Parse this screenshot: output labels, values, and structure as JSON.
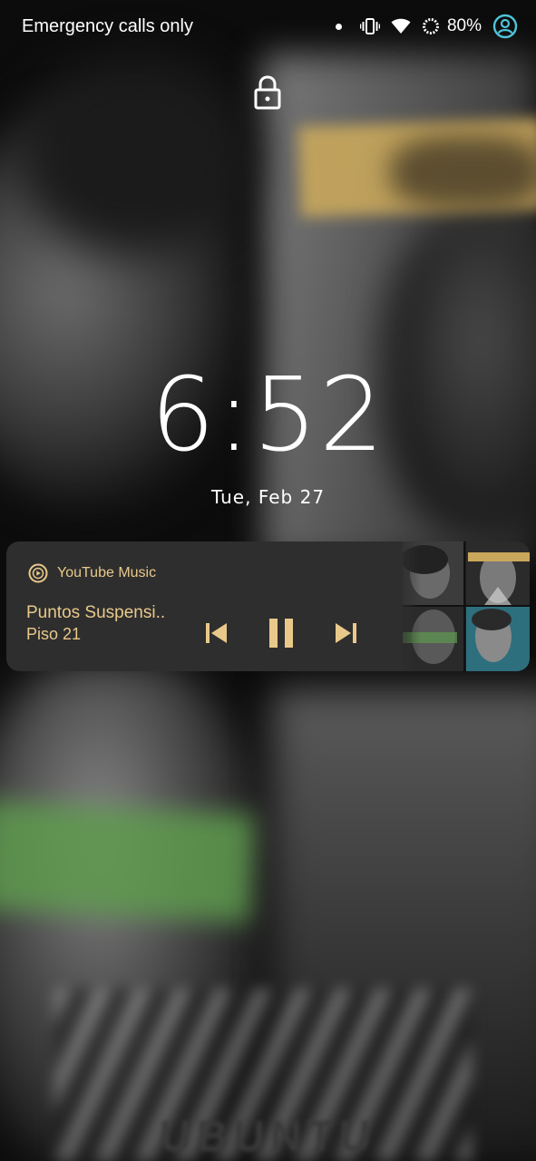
{
  "status_bar": {
    "carrier_text": "Emergency calls only",
    "battery_percent": "80%",
    "icons": [
      "notification-dot",
      "vibrate-icon",
      "wifi-icon",
      "battery-saver-icon",
      "account-icon"
    ]
  },
  "lockscreen": {
    "lock_icon": "lock-icon",
    "time": "6:52",
    "date": "Tue, Feb 27"
  },
  "media": {
    "app_name": "YouTube Music",
    "track_title": "Puntos Suspensi..",
    "artist": "Piso 21",
    "controls": [
      "previous-icon",
      "pause-icon",
      "next-icon"
    ],
    "accent_color": "#e9c98a",
    "card_color": "#2e2e2e"
  },
  "wallpaper": {
    "bottom_text": "UBUNTU"
  }
}
